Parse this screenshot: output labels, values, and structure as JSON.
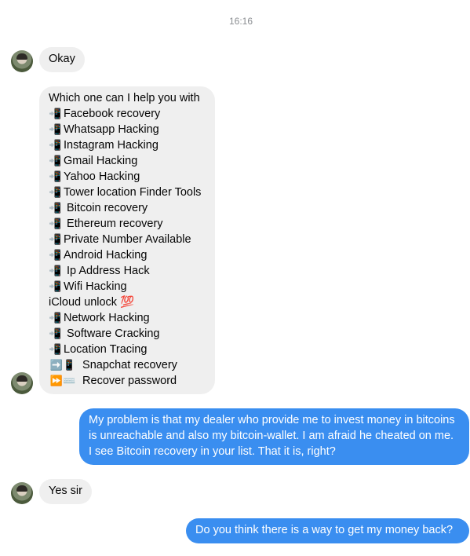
{
  "timestamp": "16:16",
  "messages": [
    {
      "text": "Okay"
    },
    {
      "lines": [
        {
          "text": "Which one can I help you with"
        },
        {
          "icon": "📲",
          "text": "Facebook  recovery"
        },
        {
          "icon": "📲",
          "text": "Whatsapp Hacking"
        },
        {
          "icon": "📲",
          "text": "Instagram Hacking"
        },
        {
          "icon": "📲",
          "text": "Gmail Hacking"
        },
        {
          "icon": "📲",
          "text": "Yahoo Hacking"
        },
        {
          "icon": "📲",
          "text": "Tower location Finder Tools"
        },
        {
          "icon": "📲",
          "text": " Bitcoin recovery"
        },
        {
          "icon": "📲",
          "text": " Ethereum recovery"
        },
        {
          "icon": "📲",
          "text": "Private Number Available"
        },
        {
          "icon": "📲",
          "text": "Android Hacking"
        },
        {
          "icon": "📲",
          "text": " Ip Address Hack"
        },
        {
          "icon": "📲",
          "text": "Wifi Hacking"
        },
        {
          "text": "iCloud unlock 💯"
        },
        {
          "icon": "📲",
          "text": "Network Hacking"
        },
        {
          "icon": "📲",
          "text": " Software Cracking"
        },
        {
          "icon": "📲",
          "text": "Location Tracing"
        },
        {
          "icon": "➡️📱",
          "text": " Snapchat recovery"
        },
        {
          "icon": "⏩⌨️",
          "text": " Recover password"
        }
      ]
    },
    {
      "text": "My problem is that my dealer who provide me to invest money in bitcoins is unreachable and also my bitcoin-wallet. I am afraid he cheated on me. I see Bitcoin recovery in your list. That it is, right?"
    },
    {
      "text": "Yes sir"
    },
    {
      "text": "Do you think there is a way to get my money back?"
    }
  ],
  "colors": {
    "incoming": "#efefef",
    "outgoing": "#3a8ef0",
    "timestamp": "#8a8d91"
  },
  "icons": {
    "avatar": "contact-avatar"
  }
}
